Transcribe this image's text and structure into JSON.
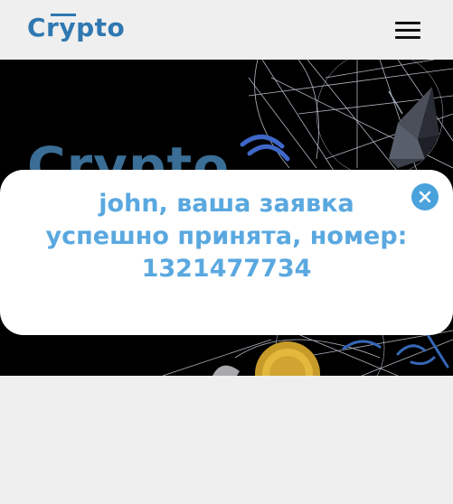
{
  "header": {
    "logo_text": "Crypto",
    "menu_icon": "hamburger-menu-icon"
  },
  "hero": {
    "title": "Crypto"
  },
  "modal": {
    "message_line1": "john, ваша заявка",
    "message_line2": "успешно принята, номер:",
    "message_line3": "1321477734",
    "close_icon": "close-icon"
  },
  "colors": {
    "brand": "#2f78b1",
    "modal_text": "#5aa8e0",
    "close_button": "#4aa2dc",
    "hero_bg": "#000000",
    "page_bg": "#efefef"
  }
}
